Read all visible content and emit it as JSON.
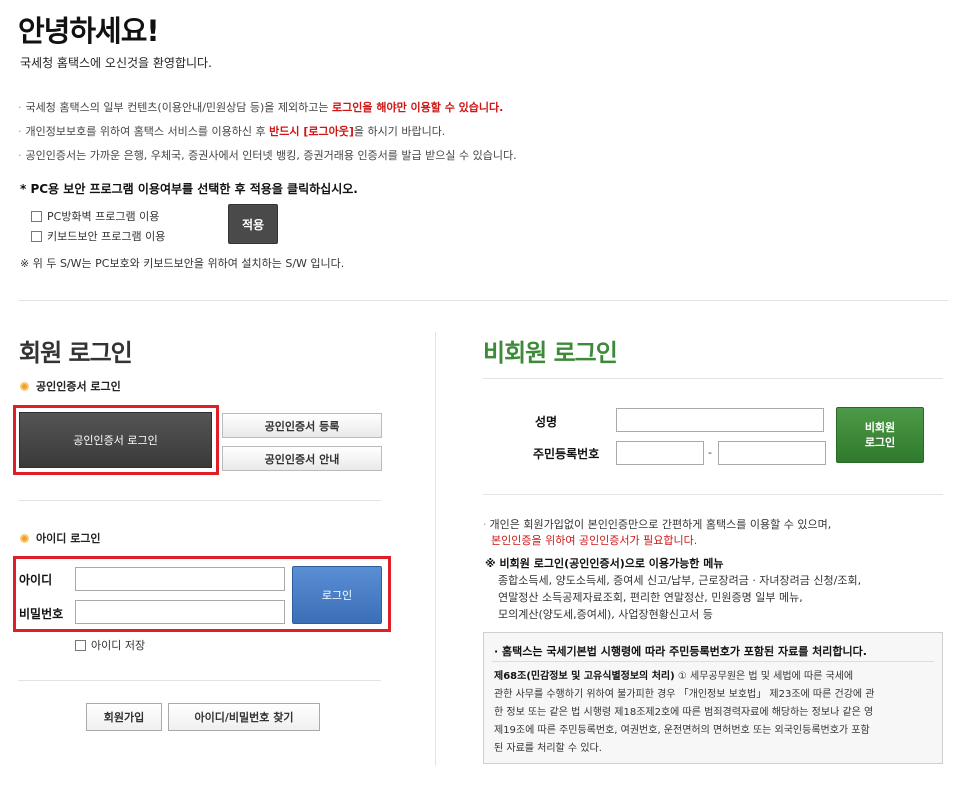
{
  "greeting": {
    "title": "안녕하세요!",
    "subtitle": "국세청 홈택스에 오신것을 환영합니다."
  },
  "notices": [
    {
      "prefix": "국세청 홈택스의 일부 컨텐츠(이용안내/민원상담 등)을 제외하고는 ",
      "emphasis": "로그인을 해야만 이용할 수 있습니다.",
      "suffix": ""
    },
    {
      "prefix": "개인정보보호를 위하여 홈택스 서비스를 이용하신 후 ",
      "emphasis": "반드시 [로그아웃]",
      "suffix": "을 하시기 바랍니다."
    },
    {
      "prefix": "공인인증서는 가까운 은행, 우체국, 증권사에서 인터넷 뱅킹, 증권거래용 인증서를 발급 받으실 수 있습니다.",
      "emphasis": "",
      "suffix": ""
    }
  ],
  "security": {
    "heading": "* PC용 보안 프로그램 이용여부를 선택한 후 적용을 클릭하십시오.",
    "option_firewall": "PC방화벽 프로그램 이용",
    "option_keyboard": "키보드보안 프로그램 이용",
    "apply_label": "적용",
    "note": "※ 위 두 S/W는 PC보호와 키보드보안을 위하여 설치하는 S/W 입니다."
  },
  "member": {
    "heading": "회원 로그인",
    "cert_section_label": "공인인증서 로그인",
    "cert_login_button": "공인인증서 로그인",
    "cert_register_button": "공인인증서 등록",
    "cert_guide_button": "공인인증서 안내",
    "id_section_label": "아이디 로그인",
    "id_label": "아이디",
    "id_value": "",
    "password_label": "비밀번호",
    "password_value": "",
    "login_button": "로그인",
    "save_id_label": "아이디 저장",
    "join_button": "회원가입",
    "find_button": "아이디/비밀번호 찾기"
  },
  "guest": {
    "heading": "비회원 로그인",
    "name_label": "성명",
    "name_value": "",
    "rrn_label": "주민등록번호",
    "rrn_front": "",
    "rrn_dash": "-",
    "rrn_back": "",
    "login_line1": "비회원",
    "login_line2": "로그인",
    "desc_line1": "개인은 회원가입없이 본인인증만으로 간편하게 홈택스를 이용할 수 있으며,",
    "desc_line2": "본인인증을 위하여 공인인증서가 필요합니다.",
    "menu_heading": "※ 비회원 로그인(공인인증서)으로 이용가능한 메뉴",
    "menu_line1": "종합소득세, 양도소득세, 증여세 신고/납부, 근로장려금 · 자녀장려금 신청/조회,",
    "menu_line2": "연말정산 소득공제자료조회, 편리한 연말정산, 민원증명 일부 메뉴,",
    "menu_line3": "모의계산(양도세,증여세), 사업장현황신고서 등",
    "info_heading": "· 홈택스는 국세기본법 시행령에 따라 주민등록번호가 포함된 자료를 처리합니다.",
    "info_bold": "제68조(민감정보 및 고유식별정보의 처리)",
    "info_line1": " ① 세무공무원은 법 및 세법에 따른 국세에",
    "info_line2": "관한 사무를 수행하기 위하여 불가피한 경우 「개인정보 보호법」 제23조에 따른 건강에 관",
    "info_line3": "한 정보 또는 같은 법 시행령 제18조제2호에 따른 범죄경력자료에 해당하는 정보나 같은 영",
    "info_line4": "제19조에 따른 주민등록번호, 여권번호, 운전면허의 면허번호 또는 외국인등록번호가 포함",
    "info_line5": "된 자료를 처리할 수 있다."
  },
  "colors": {
    "emphasis_red": "#d01515",
    "highlight_box": "#e01e26",
    "guest_green": "#3d8a3a",
    "login_blue": "#3a6fb8"
  }
}
